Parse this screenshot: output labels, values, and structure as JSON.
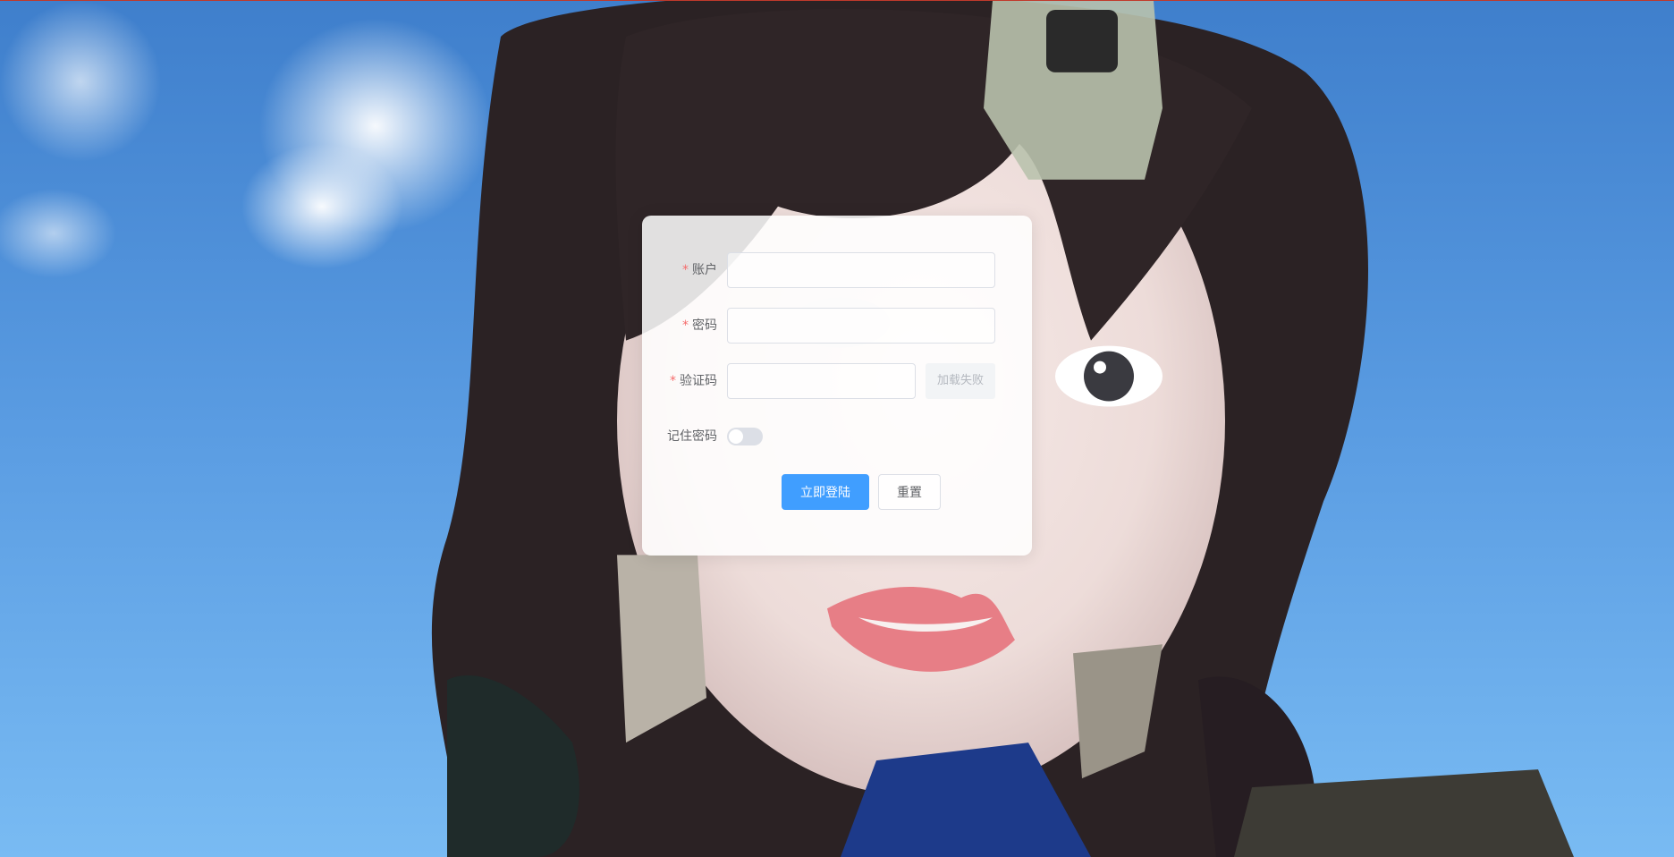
{
  "login_form": {
    "account": {
      "required_mark": "*",
      "label": "账户",
      "value": "",
      "placeholder": ""
    },
    "password": {
      "required_mark": "*",
      "label": "密码",
      "value": "",
      "placeholder": ""
    },
    "captcha": {
      "required_mark": "*",
      "label": "验证码",
      "value": "",
      "placeholder": "",
      "image_text": "加载失败"
    },
    "remember": {
      "label": "记住密码",
      "checked": false
    },
    "buttons": {
      "login_label": "立即登陆",
      "reset_label": "重置"
    }
  },
  "colors": {
    "primary": "#409eff",
    "required": "#f56c6c",
    "label_text": "#606266",
    "border": "#dcdfe6"
  },
  "icons": {
    "background": "portrait-photo"
  }
}
